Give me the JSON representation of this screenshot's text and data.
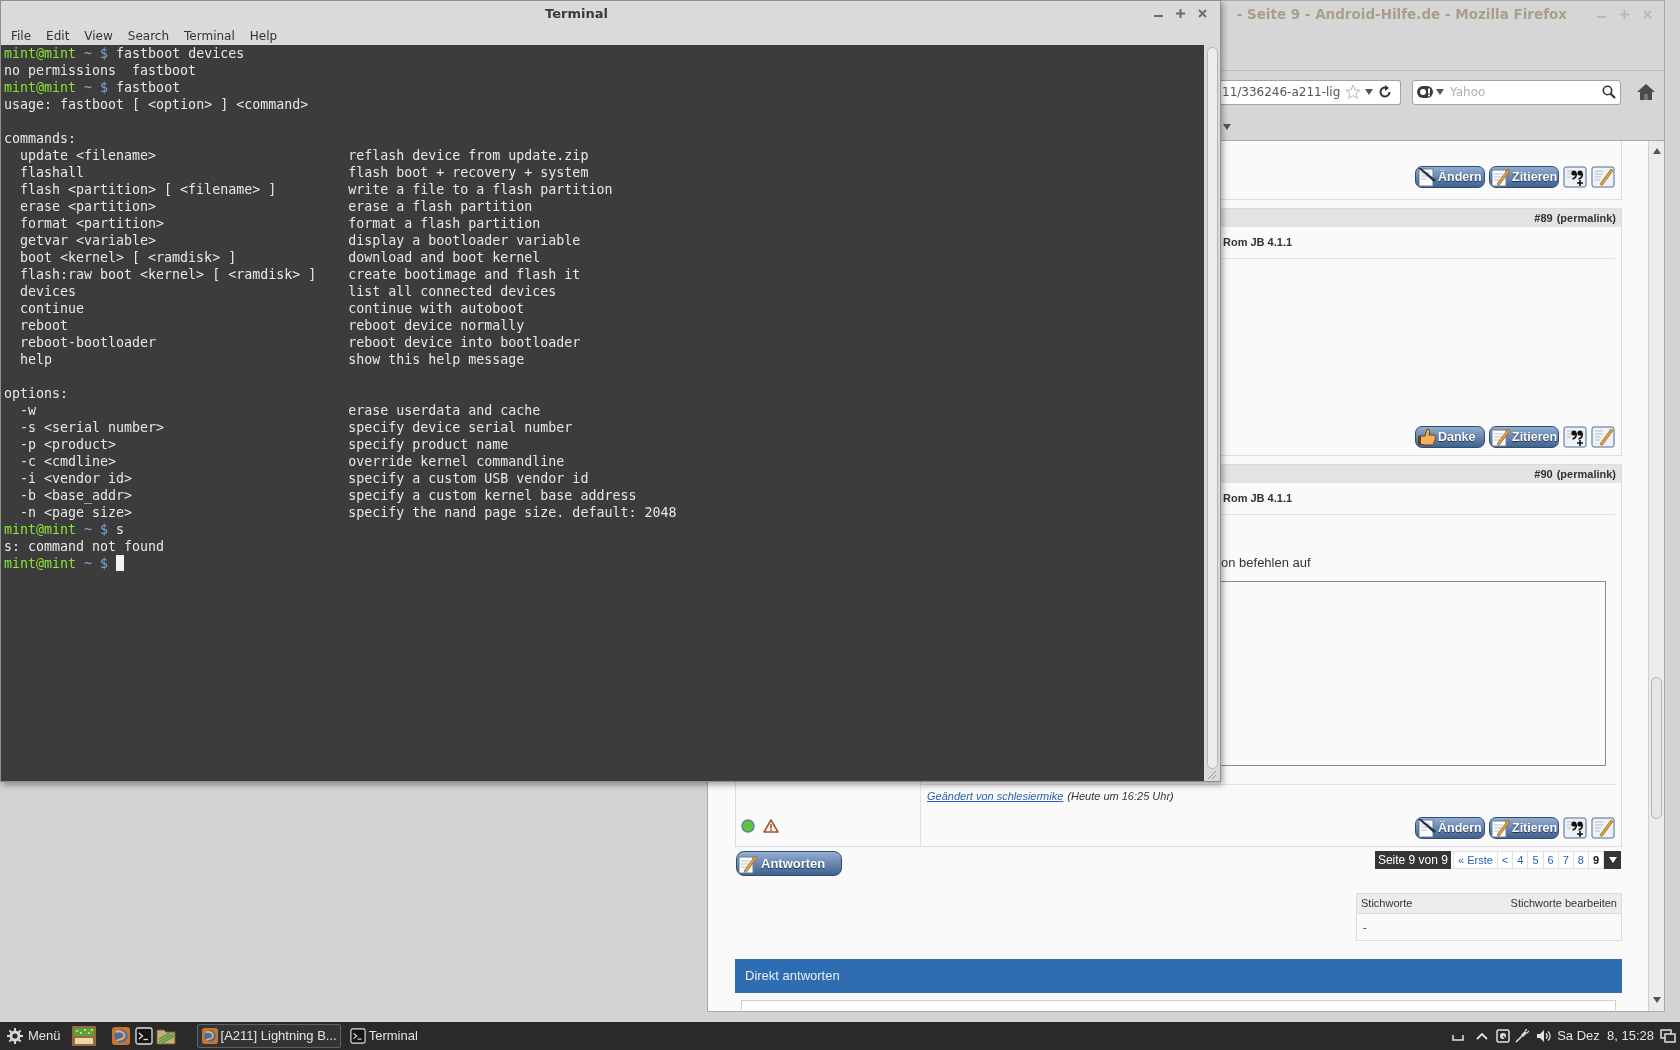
{
  "terminal": {
    "title": "Terminal",
    "menu": [
      "File",
      "Edit",
      "View",
      "Search",
      "Terminal",
      "Help"
    ],
    "lines": [
      {
        "kind": "prompt",
        "user": "mint@mint",
        "path": "~ $",
        "command": "fastboot devices",
        "cursor": false
      },
      {
        "kind": "output",
        "text": "no permissions  fastboot"
      },
      {
        "kind": "prompt",
        "user": "mint@mint",
        "path": "~ $",
        "command": "fastboot",
        "cursor": false
      },
      {
        "kind": "output",
        "text": "usage: fastboot [ <option> ] <command>"
      },
      {
        "kind": "blank"
      },
      {
        "kind": "output",
        "text": "commands:"
      },
      {
        "kind": "help",
        "option": "update <filename>",
        "description": "reflash device from update.zip"
      },
      {
        "kind": "help",
        "option": "flashall",
        "description": "flash boot + recovery + system"
      },
      {
        "kind": "help",
        "option": "flash <partition> [ <filename> ]",
        "description": "write a file to a flash partition"
      },
      {
        "kind": "help",
        "option": "erase <partition>",
        "description": "erase a flash partition"
      },
      {
        "kind": "help",
        "option": "format <partition>",
        "description": "format a flash partition"
      },
      {
        "kind": "help",
        "option": "getvar <variable>",
        "description": "display a bootloader variable"
      },
      {
        "kind": "help",
        "option": "boot <kernel> [ <ramdisk> ]",
        "description": "download and boot kernel"
      },
      {
        "kind": "help",
        "option": "flash:raw boot <kernel> [ <ramdisk> ]",
        "description": "create bootimage and flash it"
      },
      {
        "kind": "help",
        "option": "devices",
        "description": "list all connected devices"
      },
      {
        "kind": "help",
        "option": "continue",
        "description": "continue with autoboot"
      },
      {
        "kind": "help",
        "option": "reboot",
        "description": "reboot device normally"
      },
      {
        "kind": "help",
        "option": "reboot-bootloader",
        "description": "reboot device into bootloader"
      },
      {
        "kind": "help",
        "option": "help",
        "description": "show this help message"
      },
      {
        "kind": "blank"
      },
      {
        "kind": "output",
        "text": "options:"
      },
      {
        "kind": "help",
        "option": "-w",
        "description": "erase userdata and cache"
      },
      {
        "kind": "help",
        "option": "-s <serial number>",
        "description": "specify device serial number"
      },
      {
        "kind": "help",
        "option": "-p <product>",
        "description": "specify product name"
      },
      {
        "kind": "help",
        "option": "-c <cmdline>",
        "description": "override kernel commandline"
      },
      {
        "kind": "help",
        "option": "-i <vendor id>",
        "description": "specify a custom USB vendor id"
      },
      {
        "kind": "help",
        "option": "-b <base_addr>",
        "description": "specify a custom kernel base address"
      },
      {
        "kind": "help",
        "option": "-n <page size>",
        "description": "specify the nand page size. default: 2048"
      },
      {
        "kind": "prompt",
        "user": "mint@mint",
        "path": "~ $",
        "command": "s",
        "cursor": false
      },
      {
        "kind": "output",
        "text": "s: command not found"
      },
      {
        "kind": "prompt",
        "user": "mint@mint",
        "path": "~ $",
        "cursor": true
      }
    ]
  },
  "browser": {
    "title": "- Seite 9 - Android-Hilfe.de - Mozilla Firefox",
    "address": {
      "value": "11/336246-a211-lig"
    },
    "search": {
      "placeholder": "Yahoo"
    },
    "posts": [
      {
        "buttons": [
          {
            "kind": "edit",
            "label": "Ändern"
          },
          {
            "kind": "quote",
            "label": "Zitieren"
          },
          {
            "kind": "multiquote"
          },
          {
            "kind": "reply"
          }
        ]
      },
      {
        "number": "#89",
        "permalink": "(permalink)",
        "title": "Rom JB 4.1.1",
        "buttons": [
          {
            "kind": "thanks",
            "label": "Danke"
          },
          {
            "kind": "quote",
            "label": "Zitieren"
          },
          {
            "kind": "multiquote"
          },
          {
            "kind": "reply"
          }
        ]
      },
      {
        "number": "#90",
        "permalink": "(permalink)",
        "title": "Rom JB 4.1.1",
        "text": "on befehlen auf",
        "edited_by": "Geändert von schlesiermike",
        "edited_time": "(Heute um 16:25 Uhr)",
        "user_online": true,
        "buttons": [
          {
            "kind": "edit",
            "label": "Ändern"
          },
          {
            "kind": "quote",
            "label": "Zitieren"
          },
          {
            "kind": "multiquote"
          },
          {
            "kind": "reply"
          }
        ]
      }
    ],
    "reply_button": "Antworten",
    "pagination": {
      "label": "Seite 9 von 9",
      "pages": [
        {
          "text": "« Erste",
          "selected": false
        },
        {
          "text": "<",
          "selected": false
        },
        {
          "text": "4",
          "selected": false
        },
        {
          "text": "5",
          "selected": false
        },
        {
          "text": "6",
          "selected": false
        },
        {
          "text": "7",
          "selected": false
        },
        {
          "text": "8",
          "selected": false
        },
        {
          "text": "9",
          "selected": true
        }
      ]
    },
    "tags": {
      "title": "Stichworte",
      "edit_link": "Stichworte bearbeiten",
      "value": "-"
    },
    "quick_reply": {
      "title": "Direkt antworten"
    }
  },
  "taskbar": {
    "menu_label": "Menü",
    "windows": [
      {
        "kind": "browser",
        "label": "[A211] Lightning B...",
        "selected": true
      },
      {
        "kind": "terminal",
        "label": "Terminal",
        "selected": false
      }
    ],
    "clock": "Sa Dez  8, 15:28"
  }
}
